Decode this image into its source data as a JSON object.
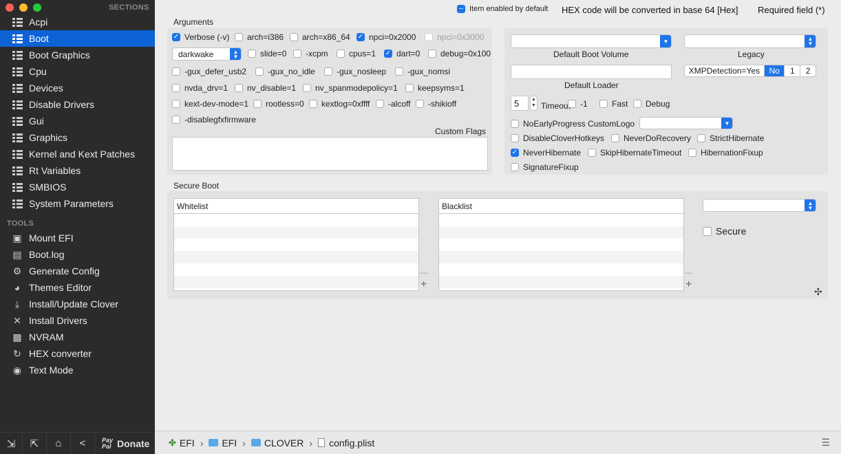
{
  "window": {
    "close_color": "#fc5f57",
    "min_color": "#fdbc2e",
    "max_color": "#28c840"
  },
  "sidebar": {
    "sections_label": "SECTIONS",
    "items": [
      {
        "label": "Acpi",
        "icon": "grid-icon"
      },
      {
        "label": "Boot",
        "icon": "grid-icon",
        "selected": true
      },
      {
        "label": "Boot Graphics",
        "icon": "grid-icon"
      },
      {
        "label": "Cpu",
        "icon": "grid-icon"
      },
      {
        "label": "Devices",
        "icon": "grid-icon"
      },
      {
        "label": "Disable Drivers",
        "icon": "grid-icon"
      },
      {
        "label": "Gui",
        "icon": "grid-icon"
      },
      {
        "label": "Graphics",
        "icon": "grid-icon"
      },
      {
        "label": "Kernel and Kext Patches",
        "icon": "grid-icon"
      },
      {
        "label": "Rt Variables",
        "icon": "grid-icon"
      },
      {
        "label": "SMBIOS",
        "icon": "grid-icon"
      },
      {
        "label": "System Parameters",
        "icon": "grid-icon"
      }
    ],
    "tools_label": "TOOLS",
    "tools": [
      {
        "label": "Mount EFI",
        "icon": "disk-icon"
      },
      {
        "label": "Boot.log",
        "icon": "document-icon"
      },
      {
        "label": "Generate Config",
        "icon": "gear-icon"
      },
      {
        "label": "Themes Editor",
        "icon": "palette-icon"
      },
      {
        "label": "Install/Update Clover",
        "icon": "download-icon"
      },
      {
        "label": "Install Drivers",
        "icon": "tools-icon"
      },
      {
        "label": "NVRAM",
        "icon": "chip-icon"
      },
      {
        "label": "HEX converter",
        "icon": "refresh-icon"
      },
      {
        "label": "Text Mode",
        "icon": "eye-icon"
      }
    ],
    "bottom": {
      "paypal_line1": "Pay",
      "paypal_line2": "Pal",
      "donate_label": "Donate"
    }
  },
  "header": {
    "item_enabled_label": "Item enabled by default",
    "hex_note": "HEX code will be converted in base 64 [Hex]",
    "required_note": "Required field (*)"
  },
  "arguments": {
    "title": "Arguments",
    "row1": [
      {
        "label": "Verbose (-v)",
        "checked": true
      },
      {
        "label": "arch=i386",
        "checked": false
      },
      {
        "label": "arch=x86_64",
        "checked": false
      },
      {
        "label": "npci=0x2000",
        "checked": true
      },
      {
        "label": "npci=0x3000",
        "checked": false,
        "disabled": true
      }
    ],
    "darkwake_value": "darkwake",
    "row2": [
      {
        "label": "slide=0",
        "checked": false
      },
      {
        "label": "-xcpm",
        "checked": false
      },
      {
        "label": "cpus=1",
        "checked": false
      },
      {
        "label": "dart=0",
        "checked": true
      },
      {
        "label": "debug=0x100",
        "checked": false
      }
    ],
    "row3": [
      {
        "label": "-gux_defer_usb2",
        "checked": false
      },
      {
        "label": "-gux_no_idle",
        "checked": false
      },
      {
        "label": "-gux_nosleep",
        "checked": false
      },
      {
        "label": "-gux_nomsi",
        "checked": false
      }
    ],
    "row4": [
      {
        "label": "nvda_drv=1",
        "checked": false
      },
      {
        "label": "nv_disable=1",
        "checked": false
      },
      {
        "label": "nv_spanmodepolicy=1",
        "checked": false
      },
      {
        "label": "keepsyms=1",
        "checked": false
      }
    ],
    "row5": [
      {
        "label": "kext-dev-mode=1",
        "checked": false
      },
      {
        "label": "rootless=0",
        "checked": false
      },
      {
        "label": "kextlog=0xffff",
        "checked": false
      },
      {
        "label": "-alcoff",
        "checked": false
      },
      {
        "label": "-shikioff",
        "checked": false
      }
    ],
    "row6": [
      {
        "label": "-disablegfxfirmware",
        "checked": false
      }
    ],
    "custom_flags_label": "Custom Flags",
    "custom_flags_value": ""
  },
  "boot": {
    "default_boot_volume_label": "Default Boot Volume",
    "default_boot_volume_value": "",
    "legacy_label": "Legacy",
    "legacy_value": "",
    "default_loader_label": "Default Loader",
    "default_loader_value": "",
    "xmp_label": "XMPDetection=Yes",
    "xmp_options": [
      "No",
      "1",
      "2"
    ],
    "xmp_selected": "No",
    "timeout_value": "5",
    "timeout_label": "Timeout",
    "timeout_checks": [
      {
        "label": "-1",
        "checked": false
      },
      {
        "label": "Fast",
        "checked": false
      },
      {
        "label": "Debug",
        "checked": false
      }
    ],
    "no_early_progress": {
      "label": "NoEarlyProgress",
      "checked": false
    },
    "custom_logo_label": "CustomLogo",
    "custom_logo_value": "",
    "flags_row1": [
      {
        "label": "DisableCloverHotkeys",
        "checked": false
      },
      {
        "label": "NeverDoRecovery",
        "checked": false
      },
      {
        "label": "StrictHibernate",
        "checked": false
      }
    ],
    "flags_row2": [
      {
        "label": "NeverHibernate",
        "checked": true
      },
      {
        "label": "SkipHibernateTimeout",
        "checked": false
      },
      {
        "label": "HibernationFixup",
        "checked": false
      }
    ],
    "flags_row3": [
      {
        "label": "SignatureFixup",
        "checked": false
      }
    ]
  },
  "secure_boot": {
    "title": "Secure Boot",
    "whitelist_header": "Whitelist",
    "blacklist_header": "Blacklist",
    "policy_value": "",
    "secure": {
      "label": "Secure",
      "checked": false
    },
    "add_symbol": "+",
    "remove_symbol": "—"
  },
  "footer": {
    "path": [
      {
        "label": "EFI",
        "icon": "clover-icon"
      },
      {
        "label": "EFI",
        "icon": "folder-icon"
      },
      {
        "label": "CLOVER",
        "icon": "folder-icon"
      },
      {
        "label": "config.plist",
        "icon": "file-icon"
      }
    ]
  }
}
